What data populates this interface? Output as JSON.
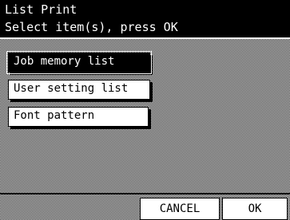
{
  "header": {
    "title": "List Print",
    "subtitle": "Select item(s), press OK"
  },
  "items": [
    {
      "label": "Job memory list",
      "selected": true
    },
    {
      "label": "User setting list",
      "selected": false
    },
    {
      "label": "Font pattern",
      "selected": false
    }
  ],
  "actions": {
    "cancel_label": "CANCEL",
    "ok_label": "OK"
  },
  "colors": {
    "header_bg": "#000000",
    "header_text": "#ffffff",
    "selected_bg": "#000000",
    "button_bg": "#ffffff"
  }
}
